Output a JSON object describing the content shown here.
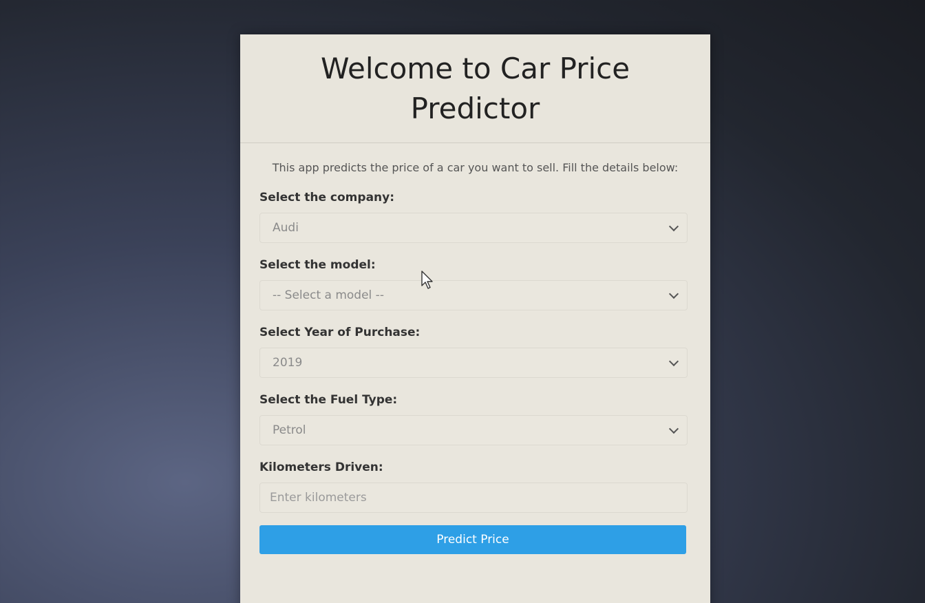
{
  "header": {
    "title": "Welcome to Car Price Predictor"
  },
  "intro_text": "This app predicts the price of a car you want to sell. Fill the details below:",
  "form": {
    "company": {
      "label": "Select the company:",
      "value": "Audi"
    },
    "model": {
      "label": "Select the model:",
      "value": "-- Select a model --"
    },
    "year": {
      "label": "Select Year of Purchase:",
      "value": "2019"
    },
    "fuel": {
      "label": "Select the Fuel Type:",
      "value": "Petrol"
    },
    "kilometers": {
      "label": "Kilometers Driven:",
      "placeholder": "Enter kilometers"
    },
    "submit_label": "Predict Price"
  },
  "colors": {
    "card_background": "#e9e6dd",
    "button": "#2e9fe6"
  }
}
